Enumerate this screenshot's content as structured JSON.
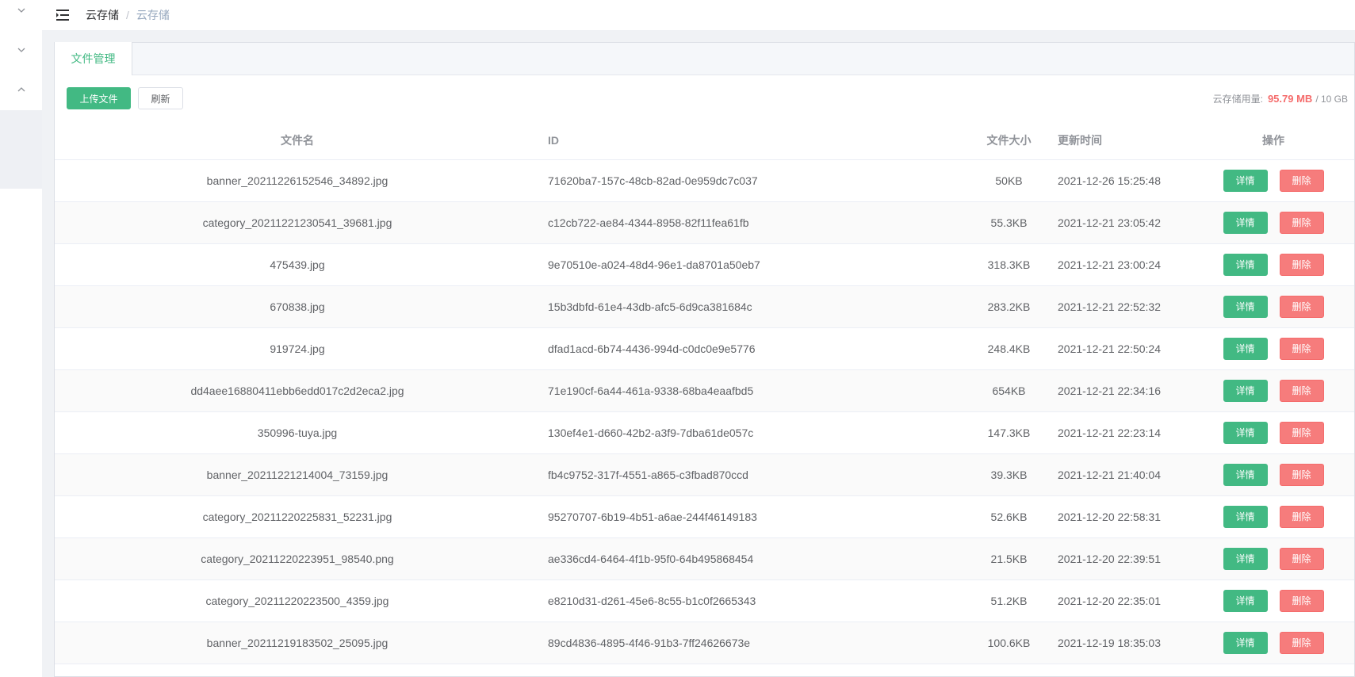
{
  "breadcrumb": {
    "first": "云存储",
    "separator": "/",
    "current": "云存储"
  },
  "tabs": [
    {
      "label": "文件管理",
      "active": true
    }
  ],
  "toolbar": {
    "upload_label": "上传文件",
    "refresh_label": "刷新"
  },
  "usage": {
    "label": "云存储用量:",
    "value": "95.79 MB",
    "total": "/ 10 GB"
  },
  "table": {
    "headers": {
      "name": "文件名",
      "id": "ID",
      "size": "文件大小",
      "time": "更新时间",
      "op": "操作"
    },
    "detail_label": "详情",
    "delete_label": "删除",
    "rows": [
      {
        "name": "banner_20211226152546_34892.jpg",
        "id": "71620ba7-157c-48cb-82ad-0e959dc7c037",
        "size": "50KB",
        "time": "2021-12-26 15:25:48"
      },
      {
        "name": "category_20211221230541_39681.jpg",
        "id": "c12cb722-ae84-4344-8958-82f11fea61fb",
        "size": "55.3KB",
        "time": "2021-12-21 23:05:42"
      },
      {
        "name": "475439.jpg",
        "id": "9e70510e-a024-48d4-96e1-da8701a50eb7",
        "size": "318.3KB",
        "time": "2021-12-21 23:00:24"
      },
      {
        "name": "670838.jpg",
        "id": "15b3dbfd-61e4-43db-afc5-6d9ca381684c",
        "size": "283.2KB",
        "time": "2021-12-21 22:52:32"
      },
      {
        "name": "919724.jpg",
        "id": "dfad1acd-6b74-4436-994d-c0dc0e9e5776",
        "size": "248.4KB",
        "time": "2021-12-21 22:50:24"
      },
      {
        "name": "dd4aee16880411ebb6edd017c2d2eca2.jpg",
        "id": "71e190cf-6a44-461a-9338-68ba4eaafbd5",
        "size": "654KB",
        "time": "2021-12-21 22:34:16"
      },
      {
        "name": "350996-tuya.jpg",
        "id": "130ef4e1-d660-42b2-a3f9-7dba61de057c",
        "size": "147.3KB",
        "time": "2021-12-21 22:23:14"
      },
      {
        "name": "banner_20211221214004_73159.jpg",
        "id": "fb4c9752-317f-4551-a865-c3fbad870ccd",
        "size": "39.3KB",
        "time": "2021-12-21 21:40:04"
      },
      {
        "name": "category_20211220225831_52231.jpg",
        "id": "95270707-6b19-4b51-a6ae-244f46149183",
        "size": "52.6KB",
        "time": "2021-12-20 22:58:31"
      },
      {
        "name": "category_20211220223951_98540.png",
        "id": "ae336cd4-6464-4f1b-95f0-64b495868454",
        "size": "21.5KB",
        "time": "2021-12-20 22:39:51"
      },
      {
        "name": "category_20211220223500_4359.jpg",
        "id": "e8210d31-d261-45e6-8c55-b1c0f2665343",
        "size": "51.2KB",
        "time": "2021-12-20 22:35:01"
      },
      {
        "name": "banner_20211219183502_25095.jpg",
        "id": "89cd4836-4895-4f46-91b3-7ff24626673e",
        "size": "100.6KB",
        "time": "2021-12-19 18:35:03"
      }
    ]
  },
  "icons": {
    "sidebar": [
      "chevron-down-icon",
      "chevron-down-icon",
      "chevron-up-icon"
    ],
    "menu_toggle": "menu-fold-icon"
  },
  "colors": {
    "primary": "#42b983",
    "danger": "#f67c7c",
    "usage_value": "#f56c6c"
  }
}
